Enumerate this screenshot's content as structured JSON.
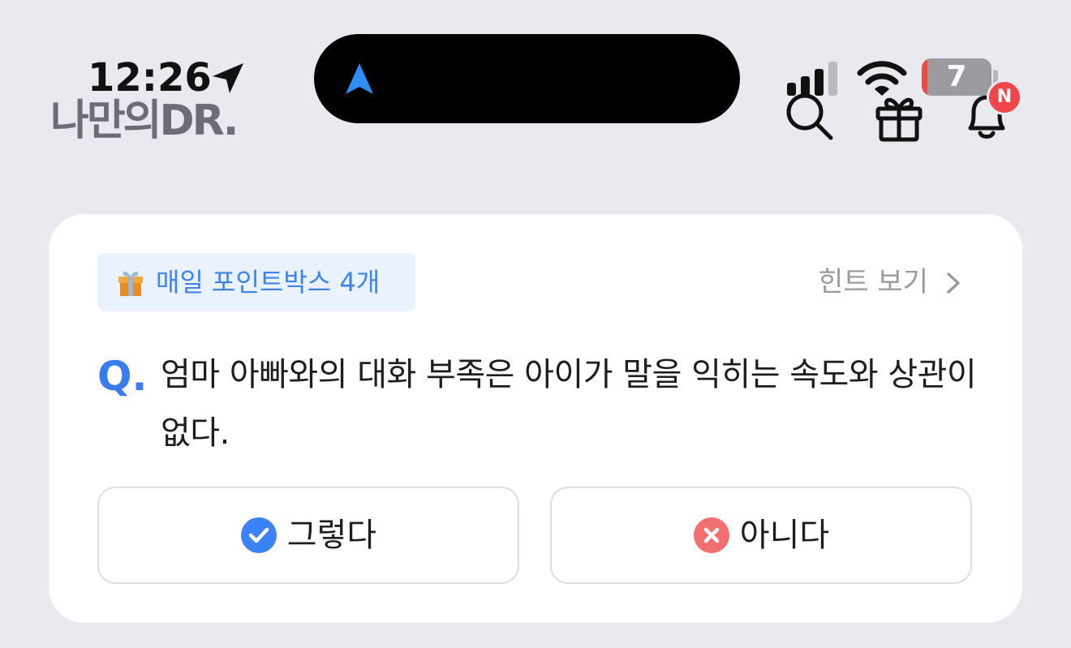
{
  "status_bar": {
    "time": "12:26",
    "battery_level": "7",
    "icons": [
      "location-arrow-icon",
      "navigation-icon",
      "signal-icon",
      "wifi-icon",
      "battery-icon"
    ]
  },
  "header": {
    "logo_text": "나만의 닥터 로고",
    "logo_display": "나만의DR.",
    "notification_badge": "N",
    "icons": [
      "search-icon",
      "gift-icon",
      "bell-icon"
    ]
  },
  "card": {
    "points_label": "매일 포인트박스 4개",
    "hint_label": "힌트 보기",
    "question_prefix": "Q.",
    "question_text": "엄마 아빠와의 대화 부족은 아이가 말을 익히는 속도와 상관이 없다.",
    "answers": [
      {
        "label": "그렇다",
        "icon": "check-circle-icon",
        "color": "#3b82f6"
      },
      {
        "label": "아니다",
        "icon": "x-circle-icon",
        "color": "#f16f6f"
      }
    ]
  },
  "colors": {
    "background": "#e9eaef",
    "card": "#ffffff",
    "accent_blue": "#3a7bef",
    "pill_bg": "#e9f2fe",
    "badge_red": "#f0454a",
    "hint_gray": "#9a9ba1"
  }
}
